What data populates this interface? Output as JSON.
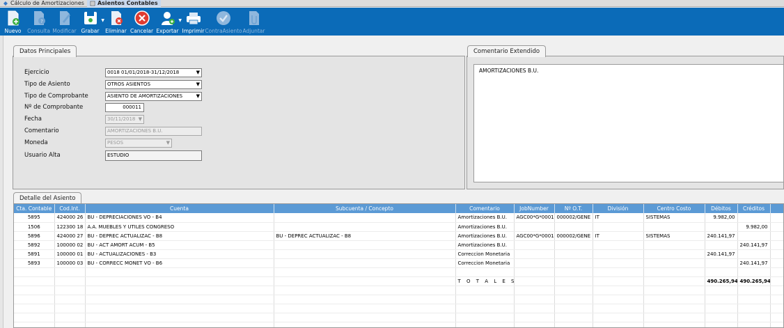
{
  "tabs": [
    {
      "label": "Cálculo de Amortizaciones",
      "active": false
    },
    {
      "label": "Asientos Contables",
      "active": true
    }
  ],
  "toolbar": {
    "nuevo": "Nuevo",
    "consulta": "Consulta",
    "modificar": "Modificar",
    "grabar": "Grabar",
    "eliminar": "Eliminar",
    "cancelar": "Cancelar",
    "exportar": "Exportar",
    "imprimir": "Imprimir",
    "contraasiento": "ContraAsiento",
    "adjuntar": "Adjuntar"
  },
  "datos": {
    "tab": "Datos Principales",
    "ejercicio_label": "Ejercicio",
    "ejercicio_value": "0018 01/01/2018-31/12/2018",
    "tipo_asiento_label": "Tipo de Asiento",
    "tipo_asiento_value": "OTROS ASIENTOS",
    "tipo_comprobante_label": "Tipo de Comprobante",
    "tipo_comprobante_value": "ASIENTO DE AMORTIZACIONES",
    "nro_comprobante_label": "Nº de Comprobante",
    "nro_comprobante_value": "000011",
    "fecha_label": "Fecha",
    "fecha_value": "30/11/2018",
    "comentario_label": "Comentario",
    "comentario_value": "AMORTIZACIONES B.U.",
    "moneda_label": "Moneda",
    "moneda_value": "PESOS",
    "usuario_label": "Usuario Alta",
    "usuario_value": "ESTUDIO"
  },
  "comentario_ext": {
    "tab": "Comentario Extendido",
    "text": "AMORTIZACIONES B.U."
  },
  "detalle": {
    "tab": "Detalle del Asiento",
    "columns": [
      "Cta. Contable",
      "Cod.Int.",
      "Cuenta",
      "Subcuenta / Concepto",
      "Comentario",
      "JobNumber",
      "Nº O.T.",
      "División",
      "Centro Costo",
      "Débitos",
      "Créditos"
    ],
    "rows": [
      [
        "5895",
        "424000 26",
        "BU - DEPRECIACIONES VO - B4",
        "",
        "Amortizaciones B.U.",
        "AGC00*G*0001",
        "000002/GENE",
        "IT",
        "SISTEMAS",
        "9.982,00",
        ""
      ],
      [
        "1506",
        "122300 18",
        "A.A. MUEBLES Y UTILES CONGRESO",
        "",
        "Amortizaciones B.U.",
        "",
        "",
        "",
        "",
        "",
        "9.982,00"
      ],
      [
        "5896",
        "424000 27",
        "BU - DEPREC ACTUALIZAC - B8",
        "BU - DEPREC ACTUALIZAC - B8",
        "Amortizaciones B.U.",
        "AGC00*G*0001",
        "000002/GENE",
        "IT",
        "SISTEMAS",
        "240.141,97",
        ""
      ],
      [
        "5892",
        "100000 02",
        "BU - ACT AMORT ACUM - B5",
        "",
        "Amortizaciones B.U.",
        "",
        "",
        "",
        "",
        "",
        "240.141,97"
      ],
      [
        "5891",
        "100000 01",
        "BU - ACTUALIZACIONES - B3",
        "",
        "Correccion Monetaria",
        "",
        "",
        "",
        "",
        "240.141,97",
        ""
      ],
      [
        "5893",
        "100000 03",
        "BU - CORRECC MONET VO - B6",
        "",
        "Correccion Monetaria",
        "",
        "",
        "",
        "",
        "",
        "240.141,97"
      ]
    ],
    "totales_label": "T O T A L E S",
    "total_debitos": "490.265,94",
    "total_creditos": "490.265,94"
  }
}
